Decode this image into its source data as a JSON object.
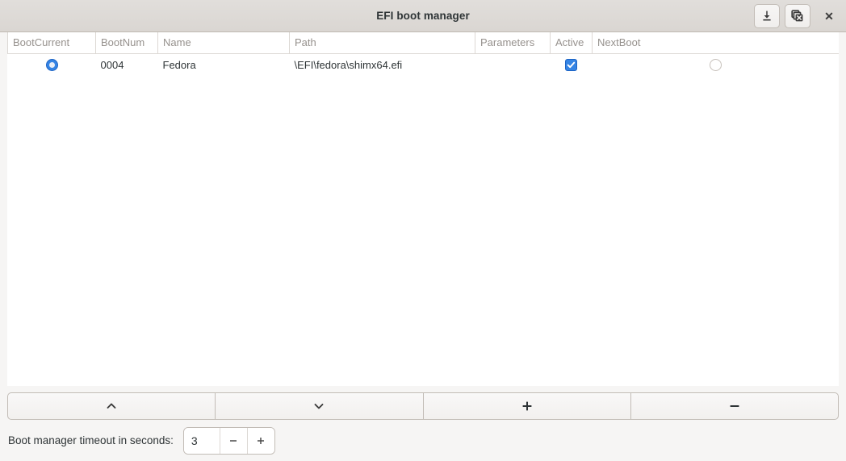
{
  "window": {
    "title": "EFI boot manager"
  },
  "titlebar": {
    "buttons": [
      {
        "name": "save-button",
        "icon": "download-icon",
        "label": ""
      },
      {
        "name": "discard-button",
        "icon": "stack-close-icon",
        "label": ""
      }
    ],
    "close_label": "✕"
  },
  "table": {
    "columns": [
      "BootCurrent",
      "BootNum",
      "Name",
      "Path",
      "Parameters",
      "Active",
      "NextBoot"
    ],
    "rows": [
      {
        "bootcurrent": true,
        "bootnum": "0004",
        "name": "Fedora",
        "path": "\\EFI\\fedora\\shimx64.efi",
        "parameters": "",
        "active": true,
        "nextboot": false
      }
    ]
  },
  "actions": [
    {
      "name": "move-up-button",
      "icon": "chevron-up-icon",
      "label": ""
    },
    {
      "name": "move-down-button",
      "icon": "chevron-down-icon",
      "label": ""
    },
    {
      "name": "add-entry-button",
      "icon": "plus-icon",
      "label": ""
    },
    {
      "name": "remove-entry-button",
      "icon": "minus-icon",
      "label": ""
    }
  ],
  "timeout": {
    "label": "Boot manager timeout in seconds:",
    "value": "3",
    "decrement_label": "−",
    "increment_label": "+"
  },
  "colors": {
    "accent": "#3584e4",
    "titlebar_bg": "#dad6d2",
    "window_bg": "#f6f5f4",
    "list_bg": "#ffffff",
    "header_text": "#96918d"
  }
}
